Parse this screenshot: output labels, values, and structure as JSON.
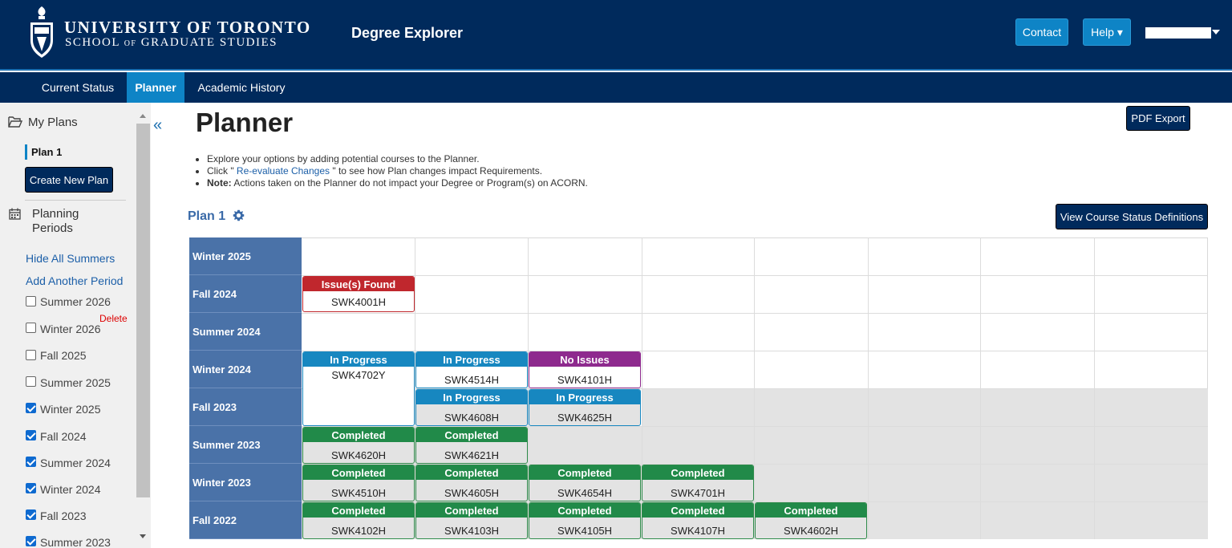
{
  "header": {
    "university": "UNIVERSITY OF TORONTO",
    "school_pre": "SCHOOL ",
    "school_of": "OF",
    "school_post": " GRADUATE STUDIES",
    "app_title": "Degree Explorer",
    "contact_label": "Contact",
    "help_label": "Help ▾"
  },
  "nav": {
    "tabs": [
      {
        "label": "Current Status"
      },
      {
        "label": "Planner"
      },
      {
        "label": "Academic History"
      }
    ]
  },
  "sidebar": {
    "my_plans": "My Plans",
    "plan_selected": "Plan 1",
    "create_plan": "Create New Plan",
    "planning_periods": "Planning",
    "planning_periods_2": "Periods",
    "hide_summers": "Hide All Summers",
    "add_period": "Add Another Period",
    "delete_label": "Delete",
    "periods": [
      {
        "label": "Summer 2026",
        "checked": false
      },
      {
        "label": "Winter 2026",
        "checked": false
      },
      {
        "label": "Fall 2025",
        "checked": false
      },
      {
        "label": "Summer 2025",
        "checked": false
      },
      {
        "label": "Winter 2025",
        "checked": true
      },
      {
        "label": "Fall 2024",
        "checked": true
      },
      {
        "label": "Summer 2024",
        "checked": true
      },
      {
        "label": "Winter 2024",
        "checked": true
      },
      {
        "label": "Fall 2023",
        "checked": true
      },
      {
        "label": "Summer 2023",
        "checked": true
      }
    ]
  },
  "main": {
    "title": "Planner",
    "pdf_export": "PDF Export",
    "bullet1": "Explore your options by adding potential courses to the Planner.",
    "bullet2_pre": "Click \"",
    "bullet2_link": " Re-evaluate Changes ",
    "bullet2_post": "\" to see how Plan changes impact Requirements.",
    "bullet3_bold": "Note:",
    "bullet3_rest": " Actions taken on the Planner do not impact your Degree or Program(s) on ACORN.",
    "plan_heading": "Plan 1",
    "status_definitions": "View Course Status Definitions"
  },
  "grid": {
    "periods": [
      "Winter 2025",
      "Fall 2024",
      "Summer 2024",
      "Winter 2024",
      "Fall 2023",
      "Summer 2023",
      "Winter 2023",
      "Fall 2022"
    ],
    "courses": {
      "fall2024_c1": {
        "status": "Issue(s) Found",
        "code": "SWK4001H"
      },
      "winter2024_c1": {
        "status": "In Progress",
        "code": "SWK4702Y"
      },
      "winter2024_c2": {
        "status": "In Progress",
        "code": "SWK4514H"
      },
      "winter2024_c3": {
        "status": "No Issues",
        "code": "SWK4101H"
      },
      "fall2023_c2": {
        "status": "In Progress",
        "code": "SWK4608H"
      },
      "fall2023_c3": {
        "status": "In Progress",
        "code": "SWK4625H"
      },
      "summer2023_c1": {
        "status": "Completed",
        "code": "SWK4620H"
      },
      "summer2023_c2": {
        "status": "Completed",
        "code": "SWK4621H"
      },
      "winter2023_c1": {
        "status": "Completed",
        "code": "SWK4510H"
      },
      "winter2023_c2": {
        "status": "Completed",
        "code": "SWK4605H"
      },
      "winter2023_c3": {
        "status": "Completed",
        "code": "SWK4654H"
      },
      "winter2023_c4": {
        "status": "Completed",
        "code": "SWK4701H"
      },
      "fall2022_c1": {
        "status": "Completed",
        "code": "SWK4102H"
      },
      "fall2022_c2": {
        "status": "Completed",
        "code": "SWK4103H"
      },
      "fall2022_c3": {
        "status": "Completed",
        "code": "SWK4105H"
      },
      "fall2022_c4": {
        "status": "Completed",
        "code": "SWK4107H"
      },
      "fall2022_c5": {
        "status": "Completed",
        "code": "SWK4602H"
      }
    }
  },
  "colors": {
    "header_bg": "#002a5c",
    "accent": "#0e84c6",
    "issue": "#c0272d",
    "in_progress": "#1787c0",
    "no_issues": "#8e2a8e",
    "completed": "#218a49"
  }
}
